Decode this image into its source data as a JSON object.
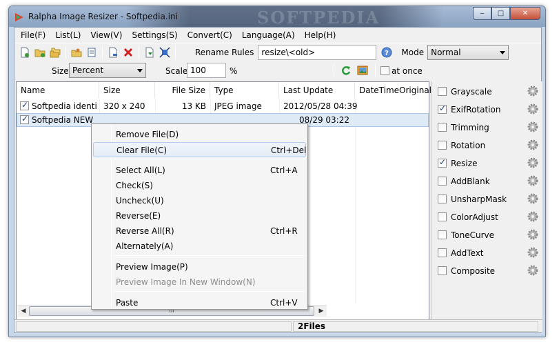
{
  "window": {
    "title": "Ralpha Image Resizer - Softpedia.ini",
    "watermark": "SOFTPEDIA",
    "controls": {
      "minimize": "‒",
      "maximize": "□",
      "close": "✕"
    }
  },
  "menubar": [
    "File(F)",
    "List(L)",
    "View(V)",
    "Settings(S)",
    "Convert(C)",
    "Language(A)",
    "Help(H)"
  ],
  "toolbar": {
    "rename_rules_label": "Rename Rules",
    "rename_rules_value": "resize\\<old>",
    "mode_label": "Mode",
    "mode_value": "Normal",
    "help_icon_glyph": "?"
  },
  "options": {
    "size_label": "Size",
    "size_value": "Percent",
    "scale_label": "Scale",
    "scale_value": "100",
    "percent_symbol": "%",
    "at_once_label": "at once",
    "at_once_checked": false
  },
  "file_list": {
    "columns": [
      "Name",
      "Size",
      "File Size",
      "Type",
      "Last Update",
      "DateTimeOriginal"
    ],
    "rows": [
      {
        "checked": true,
        "name": "Softpedia identi...",
        "size": "320 x 240",
        "file_size": "13 KB",
        "type": "JPEG image",
        "last_update": "2012/05/28 04:39"
      },
      {
        "checked": true,
        "name": "Softpedia NEW",
        "size": "",
        "file_size": "",
        "type": "",
        "last_update": "08/29 03:22"
      }
    ],
    "scroll_grip": "III",
    "scroll_left": "◀",
    "scroll_right": "▶"
  },
  "filters": [
    {
      "label": "Grayscale",
      "checked": false
    },
    {
      "label": "ExifRotation",
      "checked": true
    },
    {
      "label": "Trimming",
      "checked": false
    },
    {
      "label": "Rotation",
      "checked": false
    },
    {
      "label": "Resize",
      "checked": true
    },
    {
      "label": "AddBlank",
      "checked": false
    },
    {
      "label": "UnsharpMask",
      "checked": false
    },
    {
      "label": "ColorAdjust",
      "checked": false
    },
    {
      "label": "ToneCurve",
      "checked": false
    },
    {
      "label": "AddText",
      "checked": false
    },
    {
      "label": "Composite",
      "checked": false
    }
  ],
  "context_menu": {
    "items": [
      {
        "label": "Remove File(D)",
        "shortcut": "",
        "disabled": false,
        "highlighted": false
      },
      {
        "label": "Clear File(C)",
        "shortcut": "Ctrl+Del",
        "disabled": false,
        "highlighted": true
      },
      {
        "label": "Select All(L)",
        "shortcut": "Ctrl+A",
        "disabled": false,
        "highlighted": false
      },
      {
        "label": "Check(S)",
        "shortcut": "",
        "disabled": false,
        "highlighted": false
      },
      {
        "label": "Uncheck(U)",
        "shortcut": "",
        "disabled": false,
        "highlighted": false
      },
      {
        "label": "Reverse(E)",
        "shortcut": "",
        "disabled": false,
        "highlighted": false
      },
      {
        "label": "Reverse All(R)",
        "shortcut": "Ctrl+R",
        "disabled": false,
        "highlighted": false
      },
      {
        "label": "Alternately(A)",
        "shortcut": "",
        "disabled": false,
        "highlighted": false
      },
      {
        "label": "Preview Image(P)",
        "shortcut": "",
        "disabled": false,
        "highlighted": false
      },
      {
        "label": "Preview Image In New Window(N)",
        "shortcut": "",
        "disabled": true,
        "highlighted": false
      },
      {
        "label": "Paste",
        "shortcut": "Ctrl+V",
        "disabled": false,
        "highlighted": false
      }
    ]
  },
  "statusbar": {
    "file_count": "2Files"
  }
}
